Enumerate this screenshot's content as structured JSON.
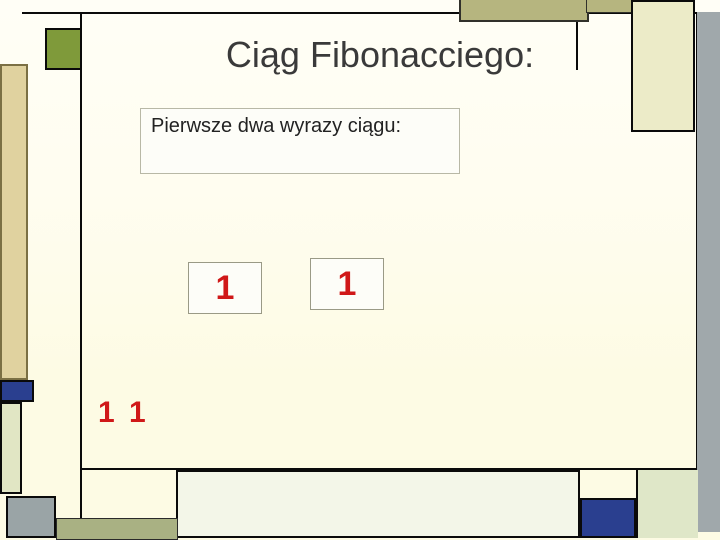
{
  "slide": {
    "title": "Ciąg  Fibonacciego:",
    "subtitle": "Pierwsze dwa wyrazy ciągu:",
    "boxed_terms": [
      "1",
      "1"
    ],
    "sequence_line": "1  1"
  },
  "colors": {
    "accent_red": "#d01818",
    "accent_blue": "#2a3f8f",
    "accent_green": "#7f9a3a",
    "olive": "#b6b57f",
    "slate": "#a0a8ab"
  }
}
